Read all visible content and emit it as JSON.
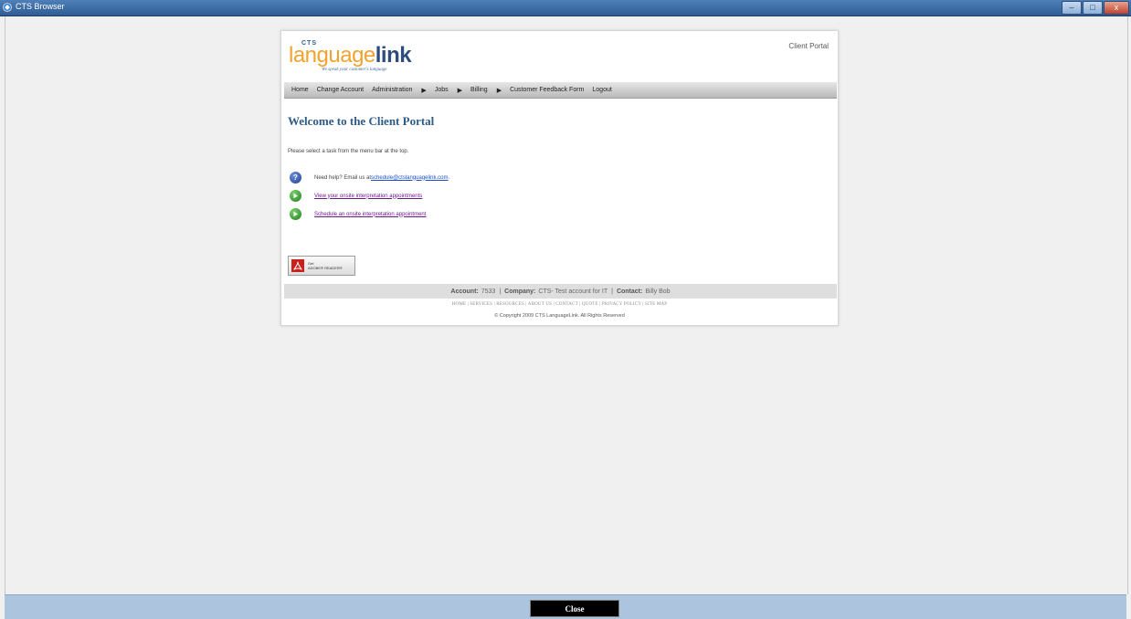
{
  "window": {
    "title": "CTS Browser",
    "minimize_glyph": "–",
    "maximize_glyph": "□",
    "close_glyph": "x"
  },
  "portal": {
    "logo": {
      "prefix": "CTS",
      "word_part1": "language",
      "word_part2": "link",
      "tagline": "We speak your customer's language"
    },
    "portal_label": "Client Portal",
    "menu": [
      {
        "label": "Home",
        "has_submenu": false
      },
      {
        "label": "Change Account",
        "has_submenu": false
      },
      {
        "label": "Administration",
        "has_submenu": true
      },
      {
        "label": "Jobs",
        "has_submenu": true
      },
      {
        "label": "Billing",
        "has_submenu": true
      },
      {
        "label": "Customer Feedback Form",
        "has_submenu": false
      },
      {
        "label": "Logout",
        "has_submenu": false
      }
    ],
    "page_title": "Welcome to the Client Portal",
    "intro": "Please select a task from the menu bar at the top.",
    "help_text": "Need help? Email us at ",
    "help_email": "schedule@ctslanguagelink.com",
    "help_suffix": ".",
    "tasks": [
      {
        "label": "View your onsite interpretation appointments",
        "icon": "play-icon"
      },
      {
        "label": "Schedule an onsite interpretation appointment",
        "icon": "play-icon"
      }
    ],
    "adobe": {
      "line1": "Get",
      "line2": "ADOBE® READER®"
    },
    "account": {
      "account_label": "Account:",
      "account_value": "7533",
      "company_label": "Company:",
      "company_value": "CTS- Test account for IT",
      "contact_label": "Contact:",
      "contact_value": "Billy Bob",
      "separator": "|"
    },
    "footer_links": "HOME | SERVICES | RESOURCES | ABOUT US | CONTACT | QUOTE | PRIVACY POLICY | SITE MAP",
    "copyright": "© Copyright 2009 CTS LanguageLink. All Rights Reserved"
  },
  "bottom": {
    "close_label": "Close"
  },
  "colors": {
    "title_blue": "#2d5a86",
    "logo_orange": "#f2a22f",
    "logo_navy": "#2e4c7e",
    "link_visited": "#6b1a8a",
    "link_blue": "#1a4fc6",
    "bottom_bar": "#adc4df"
  }
}
